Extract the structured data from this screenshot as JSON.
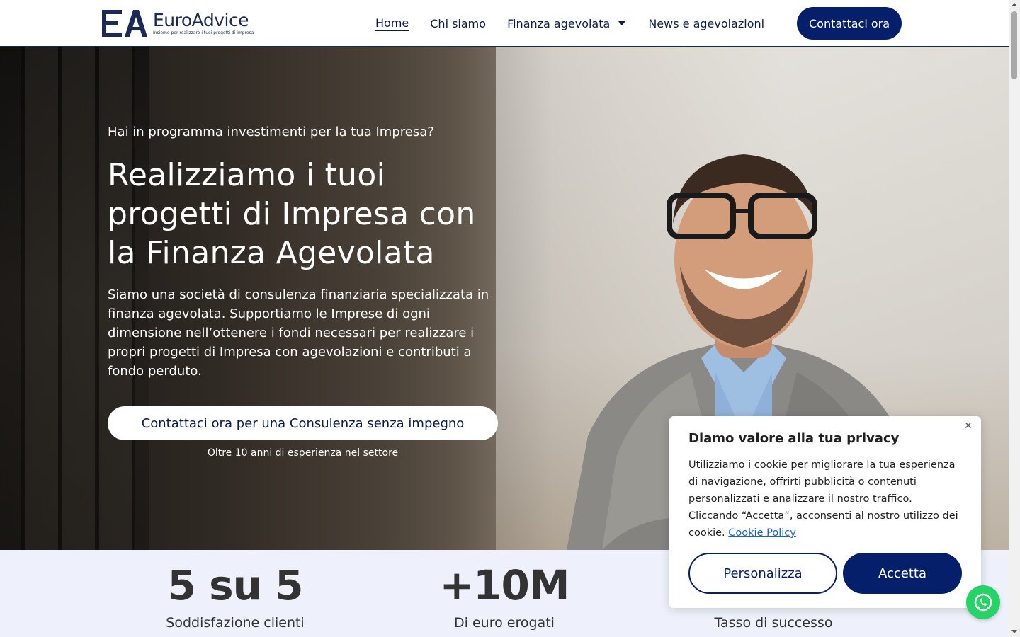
{
  "brand": {
    "name": "EuroAdvice",
    "tagline": "Insieme per realizzare i tuoi progetti di impresa",
    "color": "#061f6b"
  },
  "nav": {
    "items": [
      {
        "label": "Home",
        "active": true
      },
      {
        "label": "Chi siamo"
      },
      {
        "label": "Finanza agevolata",
        "has_dropdown": true
      },
      {
        "label": "News e agevolazioni"
      }
    ],
    "cta_label": "Contattaci ora"
  },
  "hero": {
    "eyebrow": "Hai in programma investimenti per la tua Impresa?",
    "title": "Realizziamo i tuoi progetti di Impresa con la Finanza Agevolata",
    "description": "Siamo una società di consulenza finanziaria specializzata in finanza agevolata. Supportiamo le Imprese di ogni dimensione nell’ottenere i fondi necessari per realizzare i propri progetti di Impresa con agevolazioni e contributi a fondo perduto.",
    "cta_label": "Contattaci ora per una Consulenza senza impegno",
    "note": "Oltre 10 anni di esperienza nel settore"
  },
  "stats": [
    {
      "value": "5 su 5",
      "label": "Soddisfazione clienti"
    },
    {
      "value": "+10M",
      "label": "Di euro erogati"
    },
    {
      "value": "",
      "label": "Tasso di successo"
    }
  ],
  "cookie": {
    "title": "Diamo valore alla tua privacy",
    "text": "Utilizziamo i cookie per migliorare la tua esperienza di navigazione, offrirti pubblicità o contenuti personalizzati e analizzare il nostro traffico. Cliccando “Accetta”, acconsenti al nostro utilizzo dei cookie.",
    "link_label": "Cookie Policy",
    "customize_label": "Personalizza",
    "accept_label": "Accetta",
    "close_icon": "close-icon"
  },
  "floating": {
    "whatsapp_icon": "whatsapp-icon",
    "color": "#25d366"
  }
}
